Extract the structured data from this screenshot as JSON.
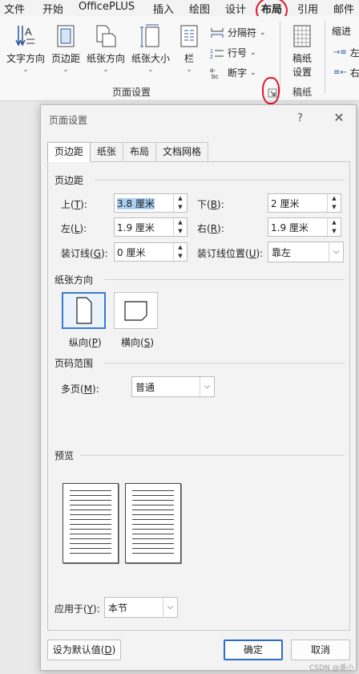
{
  "ribbon": {
    "tabs": [
      "文件",
      "开始",
      "OfficePLUS",
      "插入",
      "绘图",
      "设计",
      "布局",
      "引用",
      "邮件"
    ],
    "active_tab": "布局",
    "buttons": {
      "text_direction": "文字方向",
      "margins": "页边距",
      "orientation": "纸张方向",
      "size": "纸张大小",
      "columns": "栏",
      "breaks": "分隔符",
      "line_numbers": "行号",
      "hyphenation": "断字",
      "manuscript_line1": "稿纸",
      "manuscript_line2": "设置",
      "indent": "缩进",
      "indent_left": "左",
      "indent_right": "右"
    },
    "groups": {
      "page_setup": "页面设置",
      "manuscript": "稿纸"
    },
    "launcher_icon": "dialog-launcher-icon",
    "accent_color": "#2b579a",
    "annotation_color": "#e0152b"
  },
  "dialog": {
    "title": "页面设置",
    "help": "?",
    "close": "✕",
    "tabs": [
      "页边距",
      "纸张",
      "布局",
      "文档网格"
    ],
    "active_tab": "页边距",
    "margins_section": "页边距",
    "top_label": "上(",
    "top_key": "T",
    "top_value": "3.8 厘米",
    "bottom_label": "下(",
    "bottom_key": "B",
    "bottom_value": "2 厘米",
    "left_label": "左(",
    "left_key": "L",
    "left_value": "1.9 厘米",
    "right_label": "右(",
    "right_key": "R",
    "right_value": "1.9 厘米",
    "gutter_label": "装订线(",
    "gutter_key": "G",
    "gutter_value": "0 厘米",
    "gutter_pos_label": "装订线位置(",
    "gutter_pos_key": "U",
    "gutter_pos_value": "靠左",
    "orientation_section": "纸张方向",
    "portrait_label": "纵向(",
    "portrait_key": "P",
    "landscape_label": "横向(",
    "landscape_key": "S",
    "pages_section": "页码范围",
    "multiple_pages_label": "多页(",
    "multiple_pages_key": "M",
    "multiple_pages_value": "普通",
    "preview_section": "预览",
    "apply_to_label": "应用于(",
    "apply_to_key": "Y",
    "apply_to_value": "本节",
    "set_default": "设为默认值(",
    "set_default_key": "D",
    "ok": "确定",
    "cancel": "取消",
    "close_paren": "):",
    "close_paren_btn": ")",
    "selection_color": "#a9cff3",
    "primary_border": "#2b6cc8"
  },
  "watermark": "CSDN @遥小"
}
